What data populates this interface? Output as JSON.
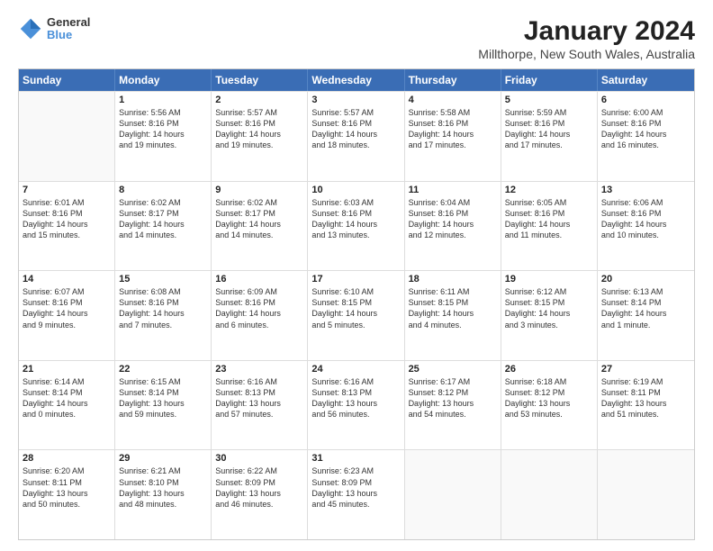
{
  "logo": {
    "line1": "General",
    "line2": "Blue"
  },
  "title": "January 2024",
  "subtitle": "Millthorpe, New South Wales, Australia",
  "days": [
    "Sunday",
    "Monday",
    "Tuesday",
    "Wednesday",
    "Thursday",
    "Friday",
    "Saturday"
  ],
  "weeks": [
    [
      {
        "day": "",
        "info": ""
      },
      {
        "day": "1",
        "info": "Sunrise: 5:56 AM\nSunset: 8:16 PM\nDaylight: 14 hours\nand 19 minutes."
      },
      {
        "day": "2",
        "info": "Sunrise: 5:57 AM\nSunset: 8:16 PM\nDaylight: 14 hours\nand 19 minutes."
      },
      {
        "day": "3",
        "info": "Sunrise: 5:57 AM\nSunset: 8:16 PM\nDaylight: 14 hours\nand 18 minutes."
      },
      {
        "day": "4",
        "info": "Sunrise: 5:58 AM\nSunset: 8:16 PM\nDaylight: 14 hours\nand 17 minutes."
      },
      {
        "day": "5",
        "info": "Sunrise: 5:59 AM\nSunset: 8:16 PM\nDaylight: 14 hours\nand 17 minutes."
      },
      {
        "day": "6",
        "info": "Sunrise: 6:00 AM\nSunset: 8:16 PM\nDaylight: 14 hours\nand 16 minutes."
      }
    ],
    [
      {
        "day": "7",
        "info": "Sunrise: 6:01 AM\nSunset: 8:16 PM\nDaylight: 14 hours\nand 15 minutes."
      },
      {
        "day": "8",
        "info": "Sunrise: 6:02 AM\nSunset: 8:17 PM\nDaylight: 14 hours\nand 14 minutes."
      },
      {
        "day": "9",
        "info": "Sunrise: 6:02 AM\nSunset: 8:17 PM\nDaylight: 14 hours\nand 14 minutes."
      },
      {
        "day": "10",
        "info": "Sunrise: 6:03 AM\nSunset: 8:16 PM\nDaylight: 14 hours\nand 13 minutes."
      },
      {
        "day": "11",
        "info": "Sunrise: 6:04 AM\nSunset: 8:16 PM\nDaylight: 14 hours\nand 12 minutes."
      },
      {
        "day": "12",
        "info": "Sunrise: 6:05 AM\nSunset: 8:16 PM\nDaylight: 14 hours\nand 11 minutes."
      },
      {
        "day": "13",
        "info": "Sunrise: 6:06 AM\nSunset: 8:16 PM\nDaylight: 14 hours\nand 10 minutes."
      }
    ],
    [
      {
        "day": "14",
        "info": "Sunrise: 6:07 AM\nSunset: 8:16 PM\nDaylight: 14 hours\nand 9 minutes."
      },
      {
        "day": "15",
        "info": "Sunrise: 6:08 AM\nSunset: 8:16 PM\nDaylight: 14 hours\nand 7 minutes."
      },
      {
        "day": "16",
        "info": "Sunrise: 6:09 AM\nSunset: 8:16 PM\nDaylight: 14 hours\nand 6 minutes."
      },
      {
        "day": "17",
        "info": "Sunrise: 6:10 AM\nSunset: 8:15 PM\nDaylight: 14 hours\nand 5 minutes."
      },
      {
        "day": "18",
        "info": "Sunrise: 6:11 AM\nSunset: 8:15 PM\nDaylight: 14 hours\nand 4 minutes."
      },
      {
        "day": "19",
        "info": "Sunrise: 6:12 AM\nSunset: 8:15 PM\nDaylight: 14 hours\nand 3 minutes."
      },
      {
        "day": "20",
        "info": "Sunrise: 6:13 AM\nSunset: 8:14 PM\nDaylight: 14 hours\nand 1 minute."
      }
    ],
    [
      {
        "day": "21",
        "info": "Sunrise: 6:14 AM\nSunset: 8:14 PM\nDaylight: 14 hours\nand 0 minutes."
      },
      {
        "day": "22",
        "info": "Sunrise: 6:15 AM\nSunset: 8:14 PM\nDaylight: 13 hours\nand 59 minutes."
      },
      {
        "day": "23",
        "info": "Sunrise: 6:16 AM\nSunset: 8:13 PM\nDaylight: 13 hours\nand 57 minutes."
      },
      {
        "day": "24",
        "info": "Sunrise: 6:16 AM\nSunset: 8:13 PM\nDaylight: 13 hours\nand 56 minutes."
      },
      {
        "day": "25",
        "info": "Sunrise: 6:17 AM\nSunset: 8:12 PM\nDaylight: 13 hours\nand 54 minutes."
      },
      {
        "day": "26",
        "info": "Sunrise: 6:18 AM\nSunset: 8:12 PM\nDaylight: 13 hours\nand 53 minutes."
      },
      {
        "day": "27",
        "info": "Sunrise: 6:19 AM\nSunset: 8:11 PM\nDaylight: 13 hours\nand 51 minutes."
      }
    ],
    [
      {
        "day": "28",
        "info": "Sunrise: 6:20 AM\nSunset: 8:11 PM\nDaylight: 13 hours\nand 50 minutes."
      },
      {
        "day": "29",
        "info": "Sunrise: 6:21 AM\nSunset: 8:10 PM\nDaylight: 13 hours\nand 48 minutes."
      },
      {
        "day": "30",
        "info": "Sunrise: 6:22 AM\nSunset: 8:09 PM\nDaylight: 13 hours\nand 46 minutes."
      },
      {
        "day": "31",
        "info": "Sunrise: 6:23 AM\nSunset: 8:09 PM\nDaylight: 13 hours\nand 45 minutes."
      },
      {
        "day": "",
        "info": ""
      },
      {
        "day": "",
        "info": ""
      },
      {
        "day": "",
        "info": ""
      }
    ]
  ]
}
